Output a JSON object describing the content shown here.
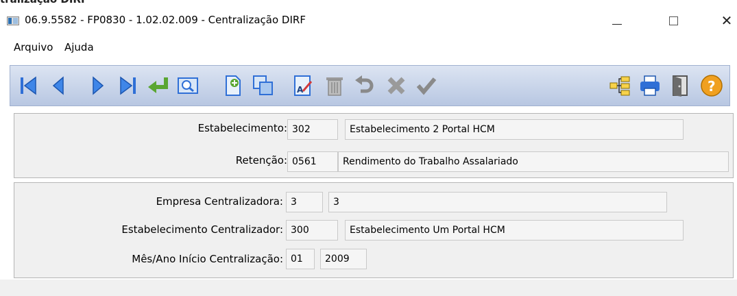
{
  "window": {
    "clipped_title": "tralização DIRF",
    "title": "06.9.5582 - FP0830 - 1.02.02.009 - Centralização DIRF",
    "minimize_glyph": "—",
    "maximize_glyph": "☐",
    "close_glyph": "✕"
  },
  "menu": {
    "arquivo": "Arquivo",
    "ajuda": "Ajuda"
  },
  "toolbar": {
    "icons": [
      "first-record-icon",
      "previous-record-icon",
      "next-record-icon",
      "last-record-icon",
      "goto-icon",
      "search-icon",
      "new-record-icon",
      "copy-record-icon",
      "edit-record-icon",
      "delete-record-icon",
      "undo-icon",
      "cancel-icon",
      "confirm-icon",
      "tree-icon",
      "print-icon",
      "exit-icon",
      "help-icon"
    ],
    "colors": {
      "blue": "#2f6fd6",
      "green": "#5aa632",
      "gray": "#8a8a8a",
      "orange": "#f0a020"
    }
  },
  "form": {
    "estabelecimento_label": "Estabelecimento:",
    "estabelecimento_code": "302",
    "estabelecimento_desc": "Estabelecimento 2 Portal HCM",
    "retencao_label": "Retenção:",
    "retencao_code": "0561",
    "retencao_desc": "Rendimento do Trabalho Assalariado",
    "empresa_label": "Empresa Centralizadora:",
    "empresa_code": "3",
    "empresa_desc": "3",
    "estab_central_label": "Estabelecimento Centralizador:",
    "estab_central_code": "300",
    "estab_central_desc": "Estabelecimento Um Portal HCM",
    "mes_ano_label": "Mês/Ano Início Centralização:",
    "mes": "01",
    "ano": "2009"
  }
}
